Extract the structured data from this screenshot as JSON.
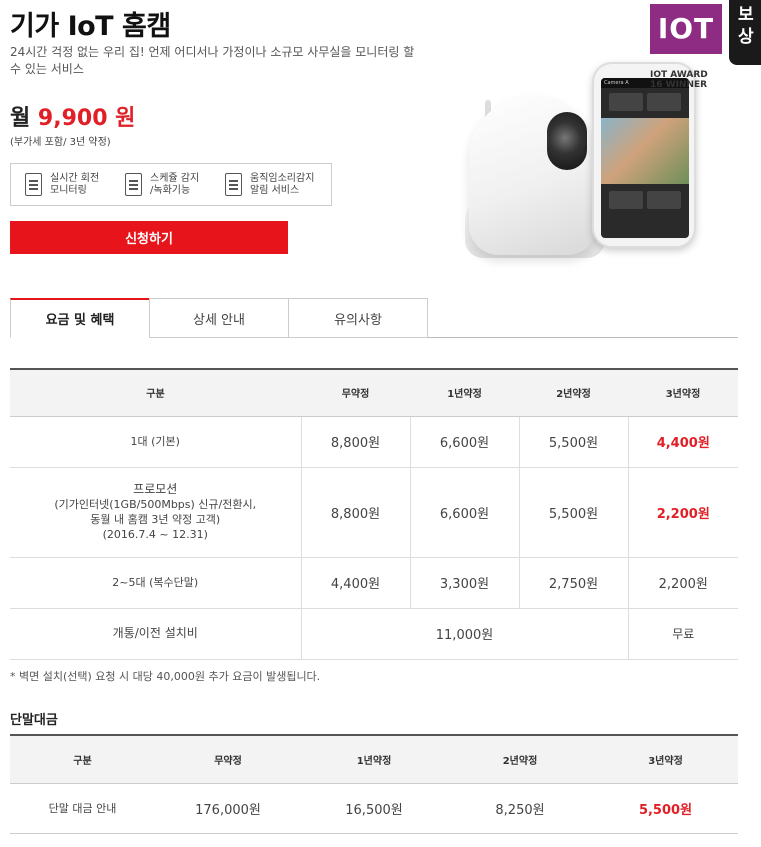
{
  "header": {
    "title": "기가 IoT 홈캠",
    "description": "24시간 걱정 없는 우리 집! 언제 어디서나 가정이나 소규모 사무실을 모니터링 할 수 있는 서비스",
    "price_prefix": "월",
    "price": "9,900 원",
    "price_note": "(부가세 포함/ 3년 약정)"
  },
  "features": [
    {
      "label": "실시간 회전\n모니터링"
    },
    {
      "label": "스케쥴 감지\n/녹화기능"
    },
    {
      "label": "움직임소리감지\n알림 서비스"
    }
  ],
  "apply_button": "신청하기",
  "badge": {
    "logo": "IOT",
    "award_line1": "IOT AWARD",
    "award_line2": "16 WINNER"
  },
  "corner_tag": "보\n상",
  "phone": {
    "top_bar": "Camera A"
  },
  "tabs": [
    "요금 및 혜택",
    "상세 안내",
    "유의사항"
  ],
  "fee_table": {
    "headers": [
      "구분",
      "무약정",
      "1년약정",
      "2년약정",
      "3년약정"
    ],
    "rows": [
      {
        "label": "1대 (기본)",
        "values": [
          "8,800원",
          "6,600원",
          "5,500원",
          "4,400원"
        ]
      },
      {
        "label_lines": [
          "프로모션",
          "(기가인터넷(1GB/500Mbps) 신규/전환시,",
          "동월 내 홈캠 3년 약정 고객)",
          "(2016.7.4 ~ 12.31)"
        ],
        "values": [
          "8,800원",
          "6,600원",
          "5,500원",
          "2,200원"
        ]
      },
      {
        "label": "2~5대 (복수단말)",
        "values": [
          "4,400원",
          "3,300원",
          "2,750원",
          "2,200원"
        ]
      },
      {
        "label": "개통/이전 설치비",
        "merged_value": "11,000원",
        "last": "무료"
      }
    ]
  },
  "fee_note": "* 벽면 설치(선택) 요청 시 대당 40,000원 추가 요금이 발생됩니다.",
  "device_section": {
    "title": "단말대금",
    "headers": [
      "구분",
      "무약정",
      "1년약정",
      "2년약정",
      "3년약정"
    ],
    "row": {
      "label": "단말 대금 안내",
      "values": [
        "176,000원",
        "16,500원",
        "8,250원",
        "5,500원"
      ]
    }
  },
  "colors": {
    "accent": "#e8141c",
    "badge": "#8e2b82"
  }
}
